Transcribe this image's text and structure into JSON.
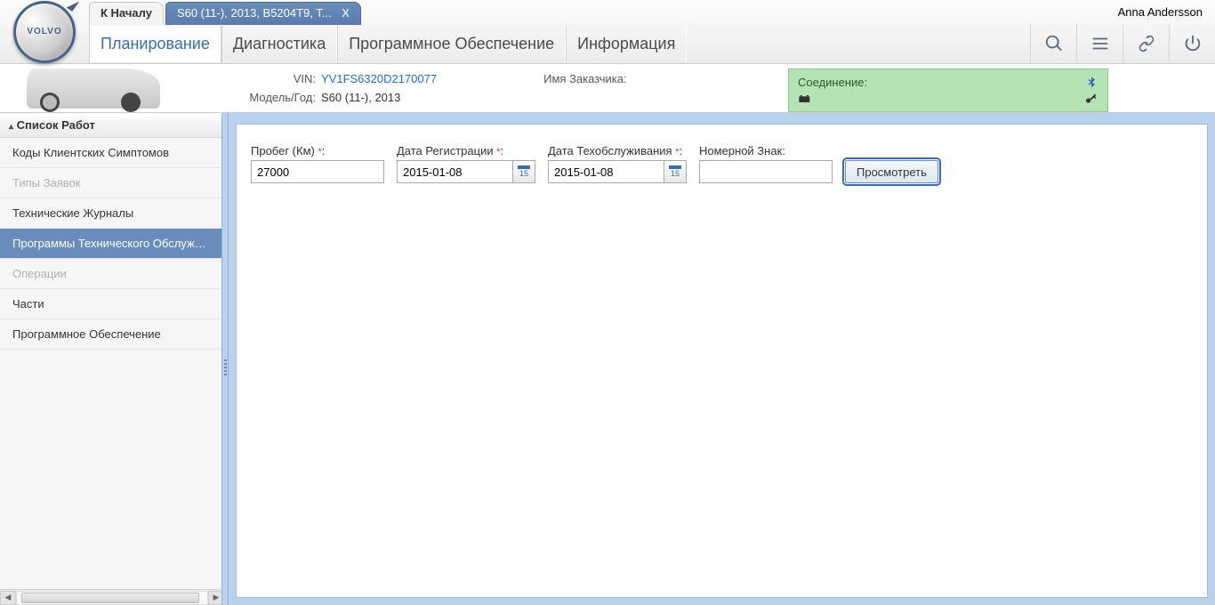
{
  "user": {
    "name": "Anna Andersson"
  },
  "logo_text": "VOLVO",
  "tabs": [
    {
      "label": "К Началу",
      "active": false
    },
    {
      "label": "S60 (11-), 2013, B5204T9, T...",
      "active": true
    }
  ],
  "nav": {
    "planning": "Планирование",
    "diagnostics": "Диагностика",
    "software": "Программное Обеспечение",
    "information": "Информация"
  },
  "vehicle": {
    "vin_label": "VIN:",
    "vin": "YV1FS6320D2170077",
    "model_label": "Модель/Год:",
    "model": "S60 (11-), 2013",
    "customer_label": "Имя Заказчика:"
  },
  "status": {
    "connection_label": "Соединение:"
  },
  "sidebar": {
    "title": "Список Работ",
    "items": [
      {
        "label": "Коды Клиентских Симптомов",
        "state": "normal"
      },
      {
        "label": "Типы Заявок",
        "state": "disabled"
      },
      {
        "label": "Технические Журналы",
        "state": "normal"
      },
      {
        "label": "Программы Технического Обслуживания",
        "state": "selected"
      },
      {
        "label": "Операции",
        "state": "disabled"
      },
      {
        "label": "Части",
        "state": "normal"
      },
      {
        "label": "Программное Обеспечение",
        "state": "normal"
      }
    ]
  },
  "form": {
    "mileage_label": "Пробег (Км) ",
    "mileage_value": "27000",
    "reg_label": "Дата Регистрации ",
    "reg_value": "2015-01-08",
    "service_label": "Дата Техобслуживания ",
    "service_value": "2015-01-08",
    "plate_label": "Номерной Знак:",
    "plate_value": "",
    "cal_day": "15",
    "view_button": "Просмотреть",
    "required_mark": "*"
  }
}
